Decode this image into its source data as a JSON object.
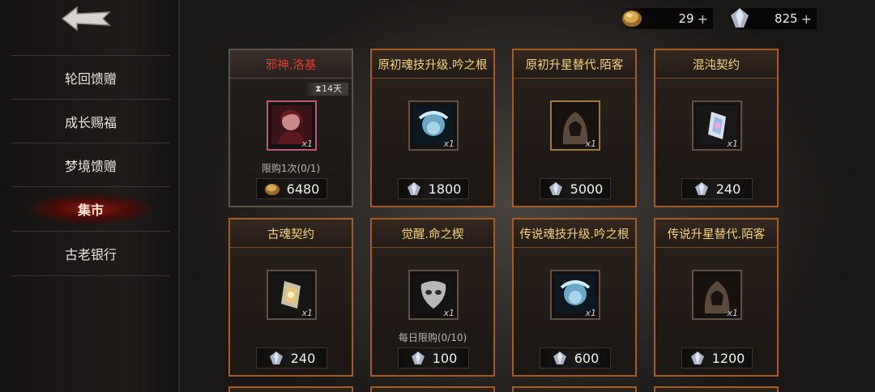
{
  "sidebar": {
    "items": [
      {
        "label": "轮回馈赠"
      },
      {
        "label": "成长赐福"
      },
      {
        "label": "梦境馈赠"
      },
      {
        "label": "集市"
      },
      {
        "label": "古老银行"
      }
    ],
    "active_index": 3
  },
  "currency": {
    "gold": {
      "amount": "29",
      "plus": "+"
    },
    "crystal": {
      "amount": "825",
      "plus": "+"
    }
  },
  "cards": [
    {
      "title": "邪神.洛基",
      "qty": "x1",
      "price": "6480",
      "currency_icon": "gold-coin-icon",
      "note": "限购1次(0/1)",
      "timer": "14天"
    },
    {
      "title": "原初魂技升级.吟之根",
      "qty": "x1",
      "price": "1800",
      "currency_icon": "crystal-icon"
    },
    {
      "title": "原初升星替代.陌客",
      "qty": "x1",
      "price": "5000",
      "currency_icon": "crystal-icon"
    },
    {
      "title": "混沌契约",
      "qty": "x1",
      "price": "240",
      "currency_icon": "crystal-icon"
    },
    {
      "title": "古魂契约",
      "qty": "x1",
      "price": "240",
      "currency_icon": "crystal-icon"
    },
    {
      "title": "觉醒.命之楔",
      "qty": "x1",
      "price": "100",
      "currency_icon": "crystal-icon",
      "note": "每日限购(0/10)"
    },
    {
      "title": "传说魂技升级.吟之根",
      "qty": "x1",
      "price": "600",
      "currency_icon": "crystal-icon"
    },
    {
      "title": "传说升星替代.陌客",
      "qty": "x1",
      "price": "1200",
      "currency_icon": "crystal-icon"
    }
  ],
  "colors": {
    "accent_orange": "#a75a22",
    "title_gold": "#f3d27a",
    "title_red": "#e23a2a",
    "active_nav_red": "#8a1a10"
  }
}
